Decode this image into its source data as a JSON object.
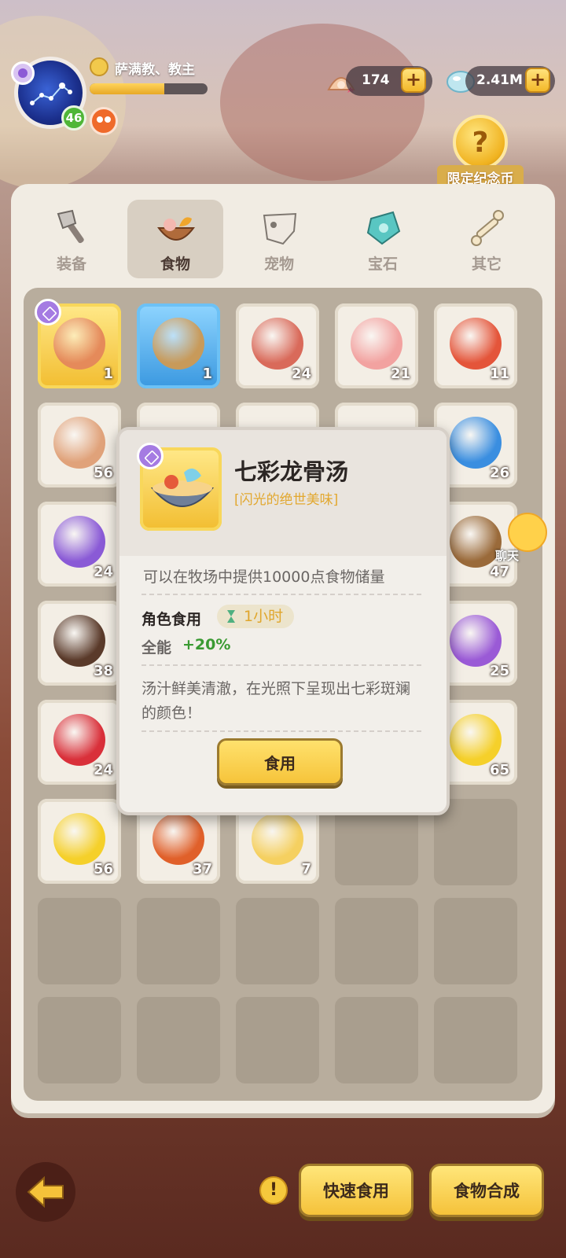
{
  "player": {
    "title": "萨满教、教主",
    "level": "46",
    "exp_fraction": 0.63
  },
  "currency": {
    "shell_value": "174",
    "gem_value": "2.41M"
  },
  "limited_coin_label": "限定纪念币",
  "tabs": [
    {
      "label": "装备",
      "icon": "axe-icon",
      "active": false
    },
    {
      "label": "食物",
      "icon": "food-bowl-icon",
      "active": true
    },
    {
      "label": "宠物",
      "icon": "pet-skull-icon",
      "active": false
    },
    {
      "label": "宝石",
      "icon": "gem-icon",
      "active": false
    },
    {
      "label": "其它",
      "icon": "bone-icon",
      "active": false
    }
  ],
  "inventory": [
    {
      "count": "1",
      "icon": "dragon-soup-icon"
    },
    {
      "count": "1",
      "icon": "grilled-dish-icon"
    },
    {
      "count": "24",
      "icon": "ham-icon"
    },
    {
      "count": "21",
      "icon": "ribs-icon"
    },
    {
      "count": "11",
      "icon": "meat-chunk-icon"
    },
    {
      "count": "56",
      "icon": "fish-icon"
    },
    {
      "count": "26",
      "icon": "lobster-icon"
    },
    {
      "count": "24",
      "icon": "crab-icon"
    },
    {
      "count": "47",
      "icon": "mushroom-icon"
    },
    {
      "count": "38",
      "icon": "coconut-icon"
    },
    {
      "count": "25",
      "icon": "grapes-icon"
    },
    {
      "count": "24",
      "icon": "pomegranate-icon"
    },
    {
      "count": "65",
      "icon": "honeycomb-icon"
    },
    {
      "count": "56",
      "icon": "lemon-icon"
    },
    {
      "count": "37",
      "icon": "herb-leaf-icon"
    },
    {
      "count": "7",
      "icon": "cheese-icon"
    }
  ],
  "popup": {
    "title": "七彩龙骨汤",
    "subtitle": "[闪光的绝世美味]",
    "description": "可以在牧场中提供10000点食物储量",
    "eat_label": "角色食用",
    "duration": "1小时",
    "stat_label": "全能",
    "stat_value": "+20%",
    "flavor_text": "汤汁鲜美清澈，在光照下呈现出七彩斑斓的颜色！",
    "eat_button": "食用"
  },
  "chat_label": "聊天",
  "bottom": {
    "quick_eat": "快速食用",
    "food_synth": "食物合成",
    "warn": "!"
  },
  "colors": {
    "accent_yellow": "#f5c23a",
    "stat_green": "#3a9a32",
    "rarity_gold": "#f2bd30",
    "rarity_blue": "#3a98e0"
  }
}
